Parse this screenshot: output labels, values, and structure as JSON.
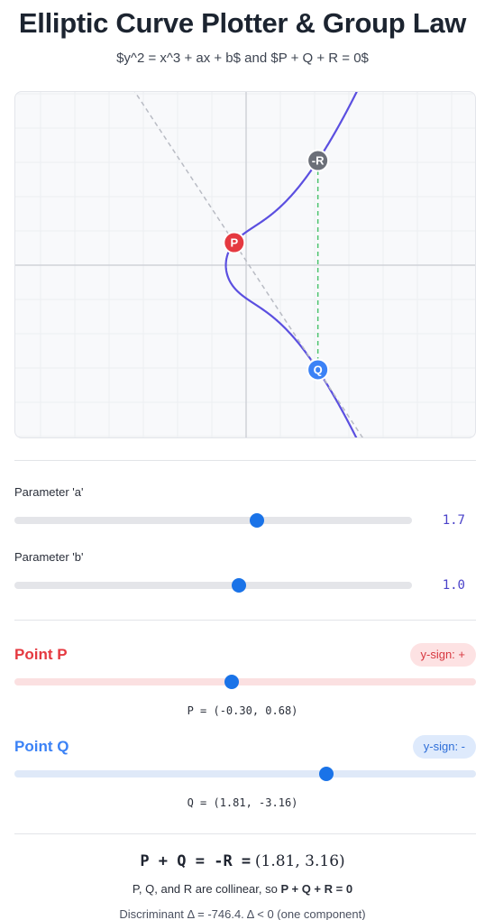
{
  "title": "Elliptic Curve Plotter & Group Law",
  "subtitle": "$y^2 = x^3 + ax + b$ and $P + Q + R = 0$",
  "colors": {
    "curve": "#5b4fe0",
    "point_p": "#e53940",
    "point_q": "#3b82f6",
    "point_neg_r": "#6b6f78",
    "secant": "#b9bcc4",
    "vertical": "#4cc36e",
    "slider_thumb": "#1a73e8"
  },
  "plot": {
    "point_p_label": "P",
    "point_q_label": "Q",
    "point_neg_r_label": "-R"
  },
  "params": {
    "a": {
      "label": "Parameter 'a'",
      "value": "1.7",
      "fraction": 0.61
    },
    "b": {
      "label": "Parameter 'b'",
      "value": "1.0",
      "fraction": 0.565
    }
  },
  "point_p": {
    "label": "Point P",
    "sign_label": "y-sign: +",
    "coord_text": "P = (-0.30, 0.68)",
    "fraction": 0.47
  },
  "point_q": {
    "label": "Point Q",
    "sign_label": "y-sign: -",
    "coord_text": "Q = (1.81, -3.16)",
    "fraction": 0.676
  },
  "result": {
    "expr": "P + Q = -R =",
    "value": "(1.81, 3.16)",
    "note_prefix": "P, Q, and R are collinear, so ",
    "note_bold": "P + Q + R = 0",
    "discriminant": "Discriminant Δ = -746.4. Δ < 0 (one component)"
  },
  "chart_data": {
    "type": "scatter",
    "title": "",
    "xlabel": "",
    "ylabel": "",
    "grid": true,
    "curve": {
      "equation": "y^2 = x^3 + 1.7x + 1.0",
      "a": 1.7,
      "b": 1.0
    },
    "points": [
      {
        "name": "P",
        "x": -0.3,
        "y": 0.68
      },
      {
        "name": "Q",
        "x": 1.81,
        "y": -3.16
      },
      {
        "name": "-R",
        "x": 1.81,
        "y": 3.16
      }
    ]
  }
}
